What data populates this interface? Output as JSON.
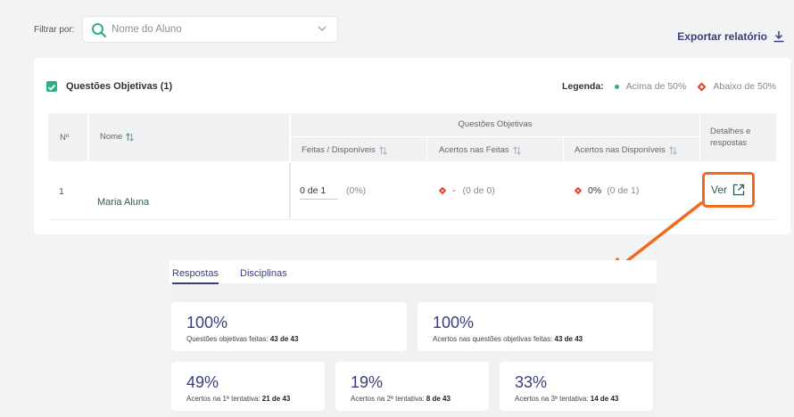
{
  "filter": {
    "label": "Filtrar por:",
    "placeholder": "Nome do Aluno"
  },
  "export": {
    "label": "Exportar relatório"
  },
  "card": {
    "title": "Questões Objetivas (1)",
    "legend": {
      "label": "Legenda:",
      "above": "Acima de 50%",
      "below": "Abaixo de 50%"
    }
  },
  "table": {
    "headers": {
      "num": "Nº",
      "name": "Nome",
      "group": "Questões Objetivas",
      "done": "Feitas / Disponíveis",
      "hits_done": "Acertos nas Feitas",
      "hits_avail": "Acertos nas Disponíveis",
      "details": "Detalhes e respostas"
    },
    "row": {
      "num": "1",
      "name": "Maria Aluna",
      "done": "0 de 1",
      "done_pct": "(0%)",
      "hits_done": "-",
      "hits_done_detail": "(0 de 0)",
      "hits_avail": "0%",
      "hits_avail_detail": "(0 de 1)",
      "action": "Ver"
    }
  },
  "panel": {
    "tabs": [
      "Respostas",
      "Disciplinas"
    ],
    "stats": [
      {
        "pct": "100%",
        "desc": "Questões objetivas feitas:",
        "value": "43 de 43"
      },
      {
        "pct": "100%",
        "desc": "Acertos nas questões objetivas feitas:",
        "value": "43 de 43"
      },
      {
        "pct": "49%",
        "desc": "Acertos na 1ª tentativa:",
        "value": "21 de 43"
      },
      {
        "pct": "19%",
        "desc": "Acertos na 2ª tentativa:",
        "value": "8 de 43"
      },
      {
        "pct": "33%",
        "desc": "Acertos na 3ª tentativa:",
        "value": "14 de 43"
      }
    ]
  },
  "colors": {
    "accent": "#3b3e7a",
    "green": "#2fae8a",
    "red": "#e0402d",
    "highlight": "#f06b1d"
  }
}
